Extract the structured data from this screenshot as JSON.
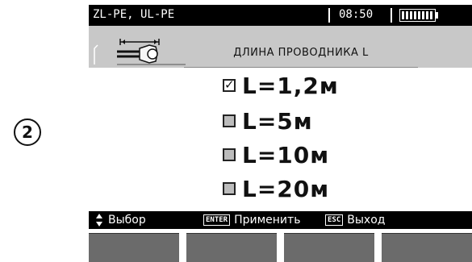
{
  "step_marker": "2",
  "status_bar": {
    "measurement": "ZL-PE, UL-PE",
    "time": "08:50",
    "battery_icon": "battery-icon"
  },
  "header": {
    "icon": "test-lead-cable-icon",
    "title": "ДЛИНА ПРОВОДНИКА L"
  },
  "options": [
    {
      "label": "L=1,2м",
      "checked": true
    },
    {
      "label": "L=5м",
      "checked": false
    },
    {
      "label": "L=10м",
      "checked": false
    },
    {
      "label": "L=20м",
      "checked": false
    }
  ],
  "footer": {
    "select": "Выбор",
    "enter_key": "ENTER",
    "apply": "Применить",
    "esc_key": "ESC",
    "exit": "Выход"
  },
  "softkey_count": 4
}
